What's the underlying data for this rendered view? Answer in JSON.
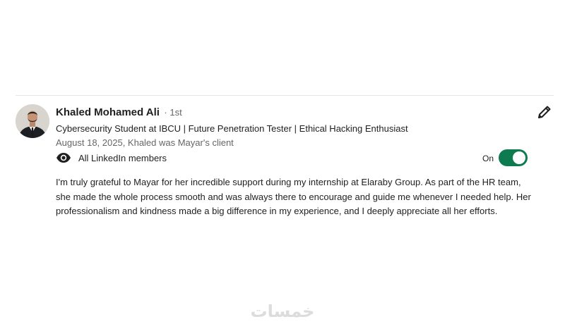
{
  "recommendation": {
    "name": "Khaled Mohamed Ali",
    "degree": "· 1st",
    "headline": "Cybersecurity Student at IBCU | Future Penetration Tester | Ethical Hacking Enthusiast",
    "meta": "August 18, 2025, Khaled was Mayar's client",
    "visibility_label": "All LinkedIn members",
    "toggle_label": "On",
    "toggle_state": "on",
    "body": "I'm truly grateful to Mayar for her incredible support during my internship at Elaraby Group. As part of the HR team, she made the whole process smooth and was always there to encourage and guide me whenever I needed help. Her professionalism and kindness made a big difference in my experience, and I deeply appreciate all her efforts."
  },
  "icons": {
    "visibility": "eye-icon",
    "edit": "pencil-icon"
  },
  "colors": {
    "toggle_on": "#0d7a50",
    "secondary_text": "#666666"
  },
  "watermark": "خمسات"
}
